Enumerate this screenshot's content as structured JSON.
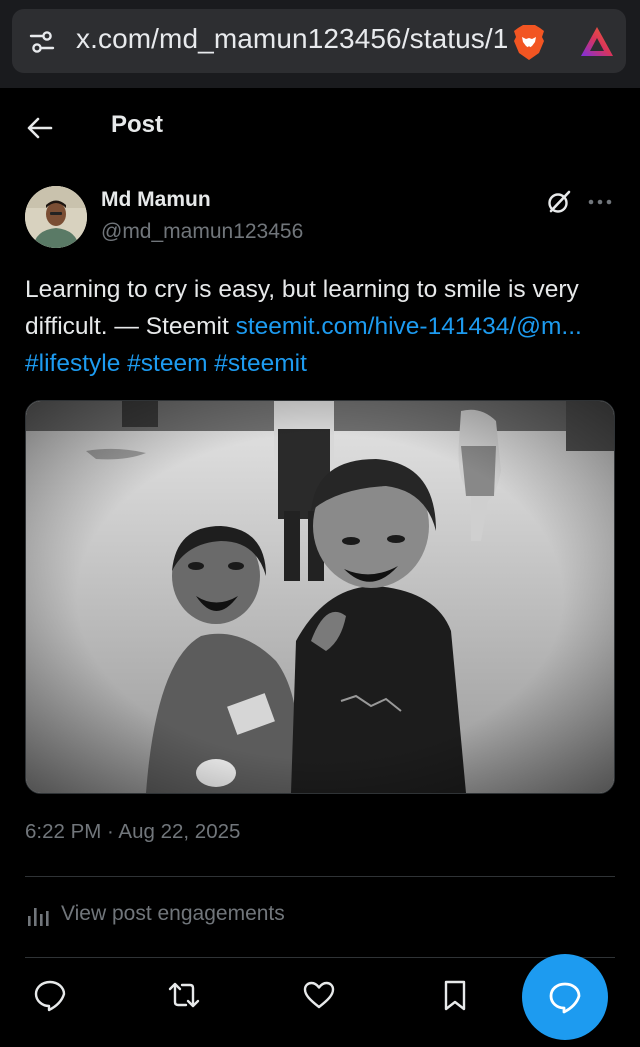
{
  "browser": {
    "url": "x.com/md_mamun123456/status/1",
    "icons": [
      "tune-icon",
      "brave-lion-icon",
      "brave-rewards-icon"
    ]
  },
  "header": {
    "title": "Post",
    "back_icon": "arrow-left-icon"
  },
  "post": {
    "author": {
      "display_name": "Md Mamun",
      "handle": "@md_mamun123456"
    },
    "text": {
      "body": "Learning to cry is easy, but learning to smile is very difficult. — Steemit ",
      "link": "steemit.com/hive-141434/@m...",
      "hashtags": [
        "#lifestyle",
        "#steem",
        "#steemit"
      ]
    },
    "timestamp": "6:22 PM · Aug 22, 2025",
    "engagements_label": "View post engagements"
  },
  "actions": [
    "reply-icon",
    "repost-icon",
    "like-icon",
    "bookmark-icon"
  ],
  "fab_icon": "new-message-icon",
  "colors": {
    "background": "#000000",
    "accent": "#1d9bf0",
    "secondary_text": "#71767b",
    "divider": "#2f3336"
  }
}
